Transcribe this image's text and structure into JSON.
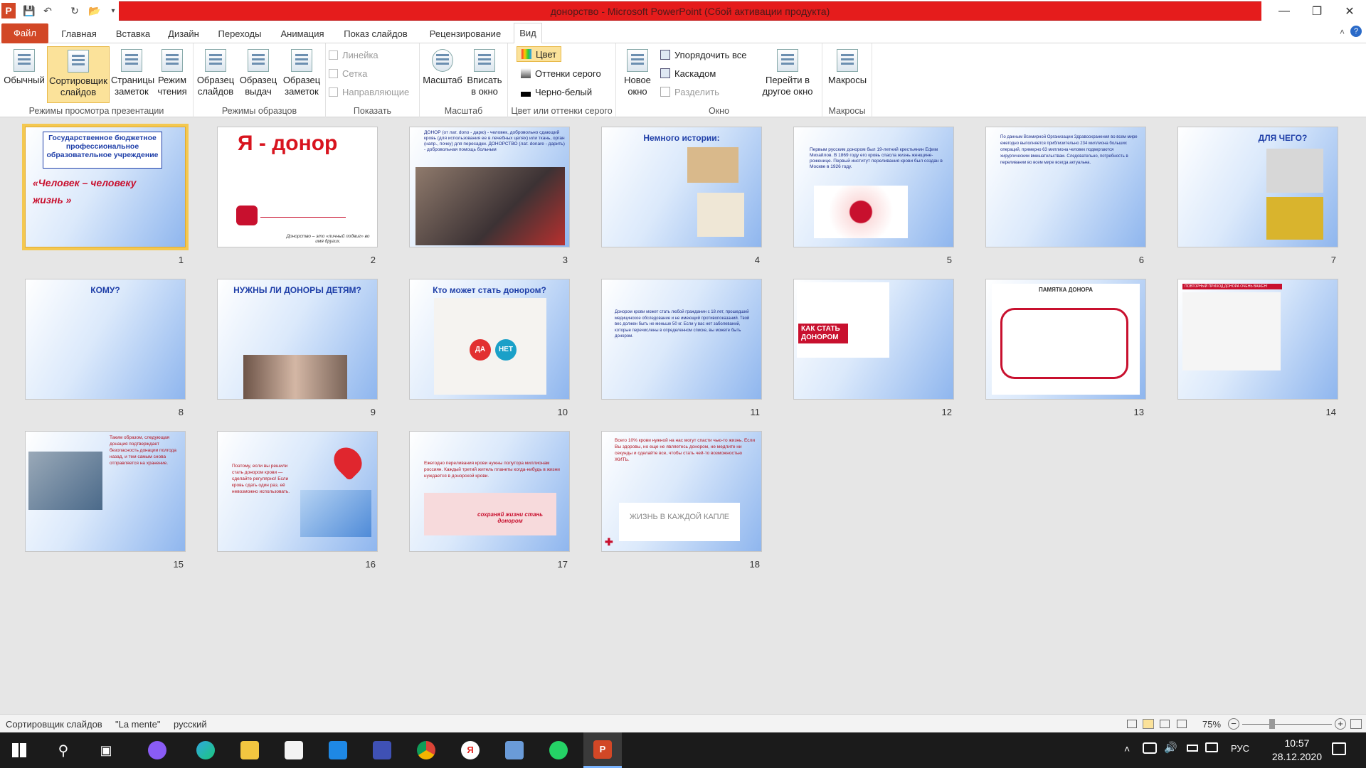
{
  "window": {
    "title": "донорство  -  Microsoft PowerPoint (Сбой активации продукта)"
  },
  "tabs": [
    "Файл",
    "Главная",
    "Вставка",
    "Дизайн",
    "Переходы",
    "Анимация",
    "Показ слайдов",
    "Рецензирование",
    "Вид"
  ],
  "ribbon": {
    "views": {
      "label": "Режимы просмотра презентации",
      "normal": "Обычный",
      "sorter": "Сортировщик слайдов",
      "notes": "Страницы заметок",
      "reading": "Режим чтения"
    },
    "masters": {
      "label": "Режимы образцов",
      "slide": "Образец слайдов",
      "handout": "Образец выдач",
      "notes": "Образец заметок"
    },
    "show": {
      "label": "Показать",
      "ruler": "Линейка",
      "grid": "Сетка",
      "guides": "Направляющие"
    },
    "zoom": {
      "label": "Масштаб",
      "zoom": "Масштаб",
      "fit": "Вписать в окно"
    },
    "color": {
      "label": "Цвет или оттенки серого",
      "color": "Цвет",
      "gray": "Оттенки серого",
      "bw": "Черно-белый"
    },
    "window": {
      "label": "Окно",
      "new": "Новое окно",
      "arrange": "Упорядочить все",
      "cascade": "Каскадом",
      "split": "Разделить",
      "switch": "Перейти в другое окно"
    },
    "macros": {
      "label": "Макросы",
      "macros": "Макросы"
    }
  },
  "slides": [
    {
      "num": "1",
      "title": "Государственное бюджетное профессиональное образовательное учреждение",
      "subtitle": "«Человек – человеку жизнь »"
    },
    {
      "num": "2",
      "title": "Я - донор",
      "caption": "Донорство – это «личный подвиг» во имя других."
    },
    {
      "num": "3",
      "text": "ДОНОР (от лат. dono - дарю) - человек, добровольно сдающий кровь (для использования ее в лечебных целях) или ткань, орган (напр., почку) для пересадки. ДОНОРСТВО (лат. donare - дарить) - добровольная помощь больным"
    },
    {
      "num": "4",
      "title": "Немного истории:"
    },
    {
      "num": "5",
      "text": "Первым русским донором был 19-летний крестьянин Ефим Михайлов. В 1869 году его кровь спасла жизнь женщине-роженице. Первый институт переливания крови был создан в Москве в 1926 году."
    },
    {
      "num": "6",
      "text": "По данным Всемирной Организации Здравоохранения во всем мире ежегодно выполняется приблизительно 234 миллиона больших операций, примерно 63 миллиона человек подвергаются хирургическим вмешательствам. Следовательно, потребность в переливании во всем мире всегда актуальна."
    },
    {
      "num": "7",
      "title": "ДЛЯ ЧЕГО?"
    },
    {
      "num": "8",
      "title": "КОМУ?"
    },
    {
      "num": "9",
      "title": "НУЖНЫ ЛИ ДОНОРЫ ДЕТЯМ?"
    },
    {
      "num": "10",
      "title": "Кто может стать донором?",
      "yes": "ДА",
      "no": "НЕТ"
    },
    {
      "num": "11",
      "text": "Донором крови может стать любой гражданин с 18 лет, прошедший медицинское обследование и не имеющий противопоказаний. Твой вес должен быть не меньше 50 кг. Если у вас нет заболеваний, которые перечислены в определенном списке, вы можете быть донором."
    },
    {
      "num": "12",
      "title": "КАК СТАТЬ ДОНОРОМ"
    },
    {
      "num": "13",
      "title": "ПАМЯТКА ДОНОРА"
    },
    {
      "num": "14",
      "title": "ПОВТОРНЫЙ ПРИХОД ДОНОРА ОЧЕНЬ ВАЖЕН!"
    },
    {
      "num": "15",
      "text": "Таким образом, следующая донация подтверждает безопасность донации полгода назад, и тем самым снова отправляется на хранение."
    },
    {
      "num": "16",
      "text": "Поэтому, если вы решили стать донором крови — сделайте регулярно! Если кровь сдать один раз, её невозможно использовать."
    },
    {
      "num": "17",
      "text": "Ежегодно переливания крови нужны полутора миллионам россиян. Каждый третий житель планеты когда-нибудь в жизни нуждается в донорской крови.",
      "banner": "сохраняй жизни стань донором"
    },
    {
      "num": "18",
      "text": "Всего 10% крови нужной на нас могут спасти чью-то жизнь. Если Вы здоровы, но еще не являетесь донором, не медлите ни секунды и сделайте все, чтобы стать чей-то возможностью ЖИТЬ.",
      "banner": "ЖИЗНЬ В КАЖДОЙ КАПЛЕ"
    }
  ],
  "status": {
    "view": "Сортировщик слайдов",
    "theme": "\"La mente\"",
    "lang": "русский",
    "zoom": "75%"
  },
  "taskbar": {
    "lang": "РУС",
    "time": "10:57",
    "date": "28.12.2020"
  }
}
